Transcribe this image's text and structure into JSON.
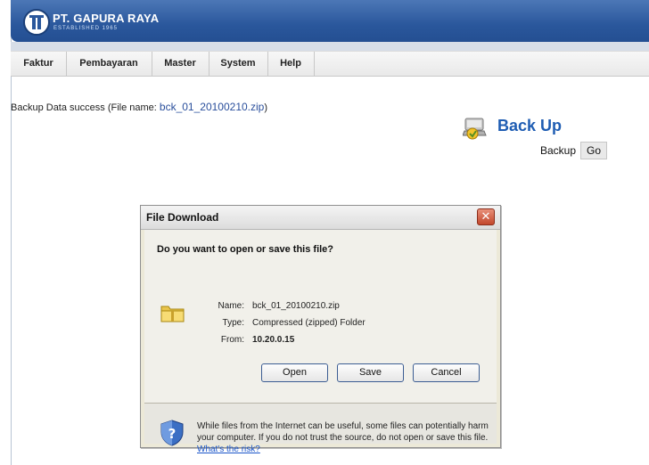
{
  "app": {
    "brand": "PT. GAPURA RAYA",
    "brand_sub": "ESTABLISHED 1965",
    "colors": {
      "header": "#2a579c",
      "accent": "#1f5db3",
      "link": "#1a55c9"
    }
  },
  "nav": {
    "items": [
      {
        "label": "Faktur"
      },
      {
        "label": "Pembayaran"
      },
      {
        "label": "Master"
      },
      {
        "label": "System"
      },
      {
        "label": "Help"
      }
    ]
  },
  "message": {
    "prefix": "Backup Data success (File name: ",
    "filename": "bck_01_20100210.zip",
    "suffix": ")"
  },
  "backup": {
    "icon": "backup-icon",
    "title": "Back Up",
    "label": "Backup",
    "go_label": "Go"
  },
  "dialog": {
    "title": "File Download",
    "close_label": "✕",
    "question": "Do you want to open or save this file?",
    "file_icon": "folder-icon",
    "name_label": "Name:",
    "name_value": "bck_01_20100210.zip",
    "type_label": "Type:",
    "type_value": "Compressed (zipped) Folder",
    "from_label": "From:",
    "from_value": "10.20.0.15",
    "open_label": "Open",
    "save_label": "Save",
    "cancel_label": "Cancel",
    "warning_icon": "shield-icon",
    "warning_text": "While files from the Internet can be useful, some files can potentially harm your computer. If you do not trust the source, do not open or save this file.",
    "warning_link": "What's the risk?"
  }
}
